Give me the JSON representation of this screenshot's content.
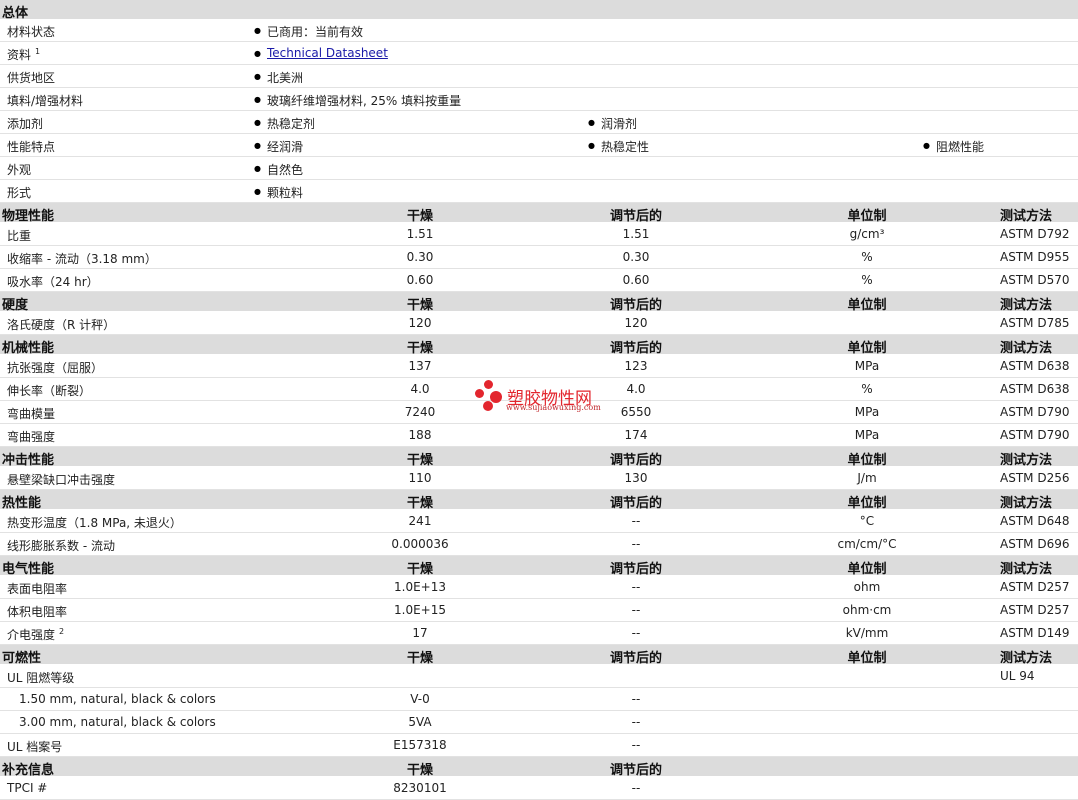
{
  "general": {
    "title": "总体",
    "rows": [
      {
        "label": "材料状态",
        "values": [
          "已商用：当前有效"
        ]
      },
      {
        "label": "资料",
        "sup": "1",
        "link": "Technical Datasheet"
      },
      {
        "label": "供货地区",
        "values": [
          "北美洲"
        ]
      },
      {
        "label": "填料/增强材料",
        "values": [
          "玻璃纤维增强材料, 25% 填料按重量"
        ]
      },
      {
        "label": "添加剂",
        "values": [
          "热稳定剂",
          "润滑剂"
        ]
      },
      {
        "label": "性能特点",
        "values": [
          "经润滑",
          "热稳定性",
          "阻燃性能"
        ]
      },
      {
        "label": "外观",
        "values": [
          "自然色"
        ]
      },
      {
        "label": "形式",
        "values": [
          "颗粒料"
        ]
      }
    ]
  },
  "column_headers": {
    "dry": "干燥",
    "conditioned": "调节后的",
    "unit": "单位制",
    "method": "测试方法"
  },
  "sections": [
    {
      "title": "物理性能",
      "rows": [
        {
          "label": "比重",
          "dry": "1.51",
          "cond": "1.51",
          "unit": "g/cm³",
          "method": "ASTM D792"
        },
        {
          "label": "收缩率 - 流动（3.18 mm）",
          "dry": "0.30",
          "cond": "0.30",
          "unit": "%",
          "method": "ASTM D955"
        },
        {
          "label": "吸水率（24 hr）",
          "dry": "0.60",
          "cond": "0.60",
          "unit": "%",
          "method": "ASTM D570"
        }
      ]
    },
    {
      "title": "硬度",
      "rows": [
        {
          "label": "洛氏硬度（R 计秤）",
          "dry": "120",
          "cond": "120",
          "unit": "",
          "method": "ASTM D785"
        }
      ]
    },
    {
      "title": "机械性能",
      "rows": [
        {
          "label": "抗张强度（屈服）",
          "dry": "137",
          "cond": "123",
          "unit": "MPa",
          "method": "ASTM D638"
        },
        {
          "label": "伸长率（断裂）",
          "dry": "4.0",
          "cond": "4.0",
          "unit": "%",
          "method": "ASTM D638"
        },
        {
          "label": "弯曲模量",
          "dry": "7240",
          "cond": "6550",
          "unit": "MPa",
          "method": "ASTM D790"
        },
        {
          "label": "弯曲强度",
          "dry": "188",
          "cond": "174",
          "unit": "MPa",
          "method": "ASTM D790"
        }
      ]
    },
    {
      "title": "冲击性能",
      "rows": [
        {
          "label": "悬壁梁缺口冲击强度",
          "dry": "110",
          "cond": "130",
          "unit": "J/m",
          "method": "ASTM D256"
        }
      ]
    },
    {
      "title": "热性能",
      "rows": [
        {
          "label": "热变形温度（1.8 MPa, 未退火）",
          "dry": "241",
          "cond": "--",
          "unit": "°C",
          "method": "ASTM D648"
        },
        {
          "label": "线形膨胀系数 - 流动",
          "dry": "0.000036",
          "cond": "--",
          "unit": "cm/cm/°C",
          "method": "ASTM D696"
        }
      ]
    },
    {
      "title": "电气性能",
      "rows": [
        {
          "label": "表面电阻率",
          "dry": "1.0E+13",
          "cond": "--",
          "unit": "ohm",
          "method": "ASTM D257"
        },
        {
          "label": "体积电阻率",
          "dry": "1.0E+15",
          "cond": "--",
          "unit": "ohm·cm",
          "method": "ASTM D257"
        },
        {
          "label": "介电强度",
          "sup": "2",
          "dry": "17",
          "cond": "--",
          "unit": "kV/mm",
          "method": "ASTM D149"
        }
      ]
    },
    {
      "title": "可燃性",
      "rows": [
        {
          "label": "UL 阻燃等级",
          "dry": "",
          "cond": "",
          "unit": "",
          "method": "UL 94"
        },
        {
          "label": "1.50 mm, natural, black & colors",
          "indent": true,
          "dry": "V-0",
          "cond": "--",
          "unit": "",
          "method": ""
        },
        {
          "label": "3.00 mm, natural, black & colors",
          "indent": true,
          "dry": "5VA",
          "cond": "--",
          "unit": "",
          "method": ""
        },
        {
          "label": "UL 档案号",
          "dry": "E157318",
          "cond": "--",
          "unit": "",
          "method": ""
        }
      ]
    },
    {
      "title": "补充信息",
      "noUnitCols": true,
      "rows": [
        {
          "label": "TPCI #",
          "dry": "8230101",
          "cond": "--",
          "unit": "",
          "method": ""
        }
      ]
    }
  ],
  "watermark": {
    "title": "塑胶物性网",
    "url": "www.sujiaowuxing.com"
  },
  "colors": {
    "header_bg": "#dcdcdc",
    "link": "#1a1aa8",
    "watermark": "#e3262e"
  }
}
